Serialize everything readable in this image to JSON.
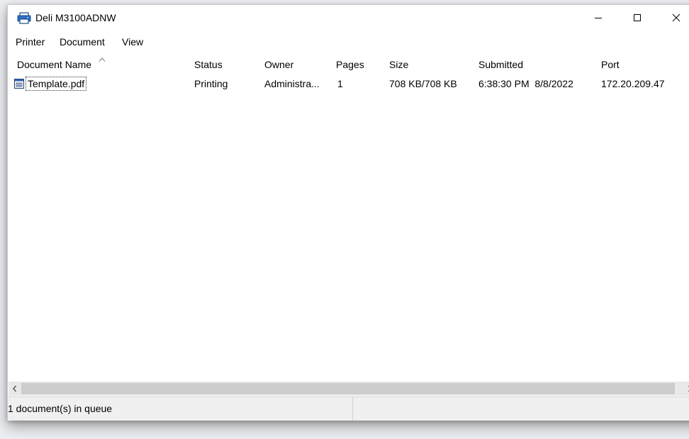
{
  "window": {
    "title": "Deli M3100ADNW"
  },
  "menu": {
    "items": [
      "Printer",
      "Document",
      "View"
    ]
  },
  "list": {
    "columns": [
      "Document Name",
      "Status",
      "Owner",
      "Pages",
      "Size",
      "Submitted",
      "Port"
    ],
    "sorted_column": "Document Name",
    "rows": [
      {
        "document_name": "Template.pdf",
        "status": "Printing",
        "owner": "Administra...",
        "pages": "1",
        "size": "708 KB/708 KB",
        "submitted": "6:38:30 PM  8/8/2022",
        "port": "172.20.209.47"
      }
    ]
  },
  "statusbar": {
    "text": "1 document(s) in queue"
  },
  "icons": {
    "title": "printer-icon",
    "document": "document-icon"
  }
}
